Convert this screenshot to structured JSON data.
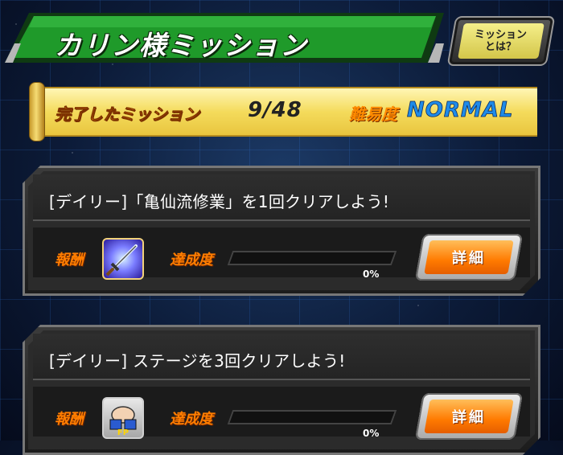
{
  "header": {
    "title": "カリン様ミッション",
    "about_button": "ミッション\nとは？"
  },
  "summary": {
    "completed_label": "完了したミッション",
    "completed_count": "9/48",
    "difficulty_label": "難易度",
    "difficulty_value": "NORMAL"
  },
  "missions": [
    {
      "title": "[デイリー]「亀仙流修業」を1回クリアしよう!",
      "reward_label": "報酬",
      "reward_icon": "sword-icon",
      "progress_label": "達成度",
      "progress": 0,
      "progress_text": "0%",
      "detail_button": "詳細"
    },
    {
      "title": "[デイリー] ステージを3回クリアしよう!",
      "reward_label": "報酬",
      "reward_icon": "friend-points-icon",
      "progress_label": "達成度",
      "progress": 0,
      "progress_text": "0%",
      "detail_button": "詳細"
    }
  ],
  "colors": {
    "banner_green": "#1f9a2a",
    "accent_orange": "#ff7e00",
    "difficulty_blue": "#1f8be8"
  }
}
